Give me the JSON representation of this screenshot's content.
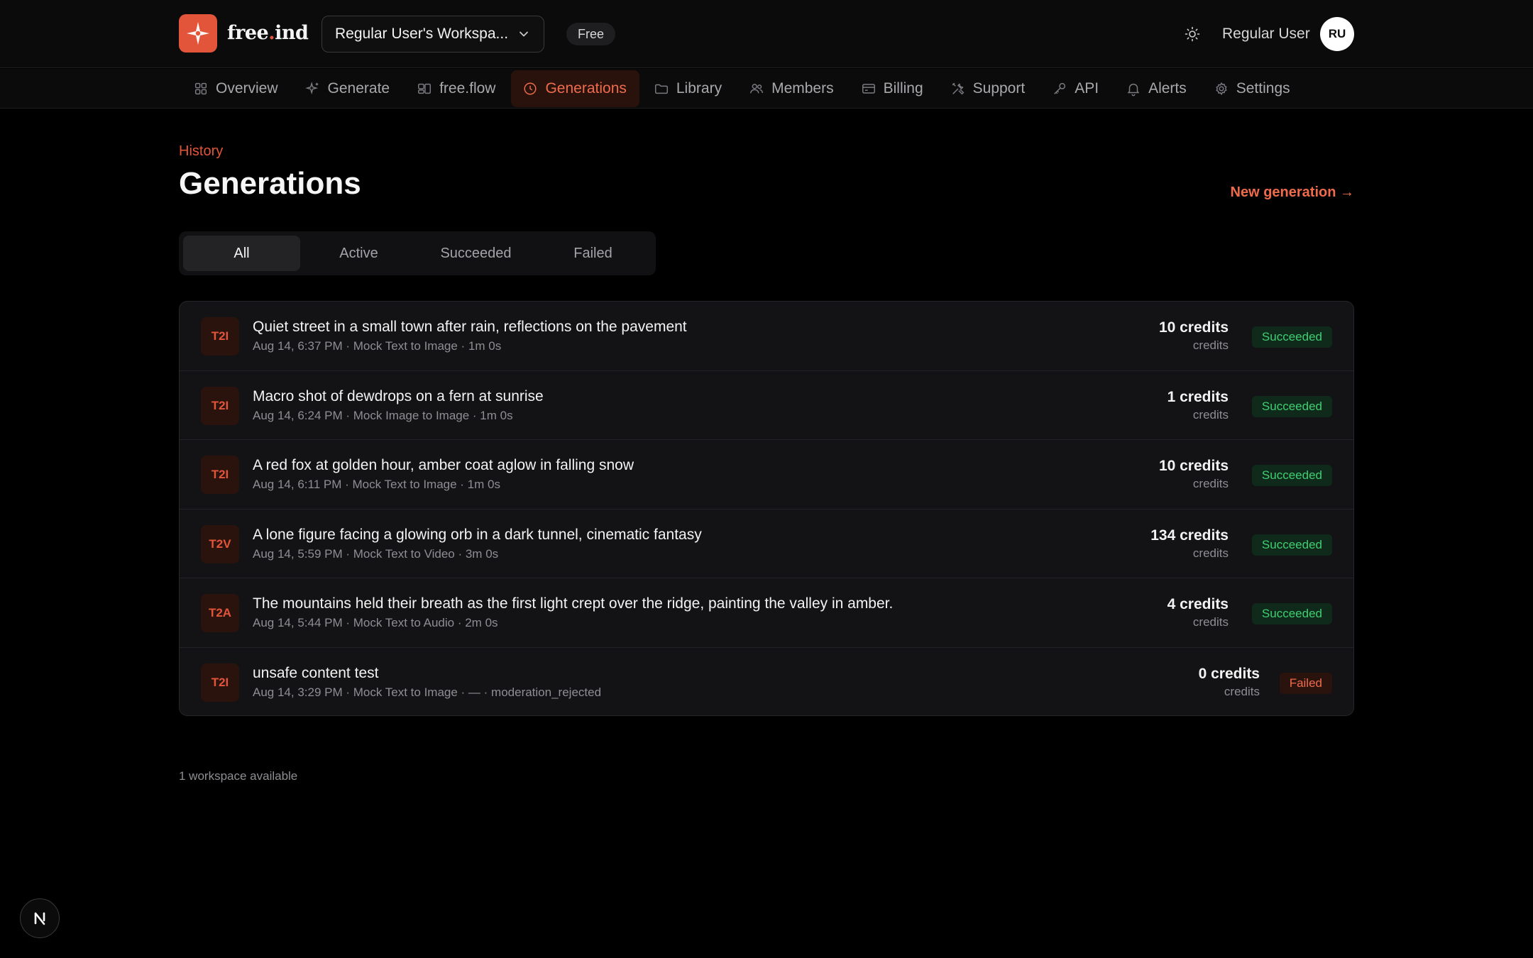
{
  "header": {
    "logo_text_a": "free",
    "logo_text_dot": ".",
    "logo_text_b": "ind",
    "workspace_label": "Regular User's Workspa...",
    "plan": "Free",
    "user_name": "Regular User",
    "avatar_initials": "RU"
  },
  "nav": {
    "items": [
      {
        "label": "Overview",
        "icon": "grid-icon"
      },
      {
        "label": "Generate",
        "icon": "sparkle-icon"
      },
      {
        "label": "free.flow",
        "icon": "flow-icon"
      },
      {
        "label": "Generations",
        "icon": "clock-icon",
        "active": true
      },
      {
        "label": "Library",
        "icon": "folder-icon"
      },
      {
        "label": "Members",
        "icon": "users-icon"
      },
      {
        "label": "Billing",
        "icon": "card-icon"
      },
      {
        "label": "Support",
        "icon": "tools-icon"
      },
      {
        "label": "API",
        "icon": "key-icon"
      },
      {
        "label": "Alerts",
        "icon": "bell-icon"
      },
      {
        "label": "Settings",
        "icon": "gear-icon"
      }
    ]
  },
  "page": {
    "eyebrow": "History",
    "title": "Generations",
    "new_generation": "New generation →"
  },
  "filters": {
    "tabs": [
      "All",
      "Active",
      "Succeeded",
      "Failed"
    ],
    "selected": "All"
  },
  "generations": [
    {
      "type": "T2I",
      "prompt": "Quiet street in a small town after rain, reflections on the pavement",
      "meta": "Aug 14, 6:37 PM · Mock Text to Image · 1m 0s",
      "credits": "10 credits",
      "credits_unit": "credits",
      "status": "Succeeded"
    },
    {
      "type": "T2I",
      "prompt": "Macro shot of dewdrops on a fern at sunrise",
      "meta": "Aug 14, 6:24 PM · Mock Image to Image · 1m 0s",
      "credits": "1 credits",
      "credits_unit": "credits",
      "status": "Succeeded"
    },
    {
      "type": "T2I",
      "prompt": "A red fox at golden hour, amber coat aglow in falling snow",
      "meta": "Aug 14, 6:11 PM · Mock Text to Image · 1m 0s",
      "credits": "10 credits",
      "credits_unit": "credits",
      "status": "Succeeded"
    },
    {
      "type": "T2V",
      "prompt": "A lone figure facing a glowing orb in a dark tunnel, cinematic fantasy",
      "meta": "Aug 14, 5:59 PM · Mock Text to Video · 3m 0s",
      "credits": "134 credits",
      "credits_unit": "credits",
      "status": "Succeeded"
    },
    {
      "type": "T2A",
      "prompt": "The mountains held their breath as the first light crept over the ridge, painting the valley in amber.",
      "meta": "Aug 14, 5:44 PM · Mock Text to Audio · 2m 0s",
      "credits": "4 credits",
      "credits_unit": "credits",
      "status": "Succeeded"
    },
    {
      "type": "T2I",
      "prompt": "unsafe content test",
      "meta": "Aug 14, 3:29 PM · Mock Text to Image · — · moderation_rejected",
      "credits": "0 credits",
      "credits_unit": "credits",
      "status": "Failed"
    }
  ],
  "footer": {
    "note": "1 workspace available",
    "dev_badge": "N"
  },
  "colors": {
    "accent": "#e2553a",
    "success": "#3fcf72",
    "background": "#000000"
  }
}
